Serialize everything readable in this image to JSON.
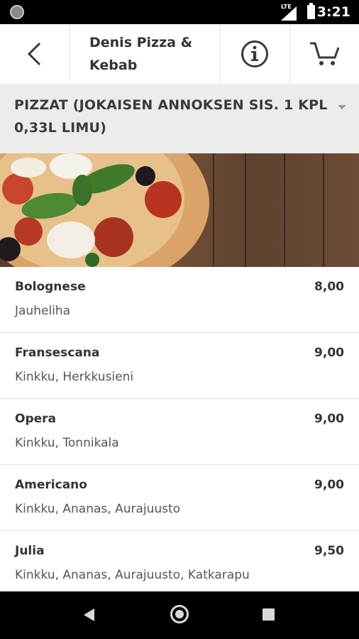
{
  "status_bar": {
    "network": "LTE",
    "time": "3:21"
  },
  "header": {
    "title": "Denis Pizza & Kebab",
    "back_icon": "chevron-left-icon",
    "info_icon": "info-circle-icon",
    "cart_icon": "cart-icon"
  },
  "category": {
    "label": "PIZZAT (JOKAISEN ANNOKSEN SIS. 1 KPL 0,33L LIMU)"
  },
  "menu": [
    {
      "name": "Bolognese",
      "desc": "Jauheliha",
      "price": "8,00"
    },
    {
      "name": "Fransescana",
      "desc": "Kinkku, Herkkusieni",
      "price": "9,00"
    },
    {
      "name": "Opera",
      "desc": "Kinkku, Tonnikala",
      "price": "9,00"
    },
    {
      "name": "Americano",
      "desc": "Kinkku, Ananas, Aurajuusto",
      "price": "9,00"
    },
    {
      "name": "Julia",
      "desc": "Kinkku, Ananas, Aurajuusto, Katkarapu",
      "price": "9,50"
    }
  ],
  "colors": {
    "header_bg": "#ffffff",
    "category_bg": "#ececec",
    "divider": "#e2e2e2",
    "text": "#333333"
  }
}
